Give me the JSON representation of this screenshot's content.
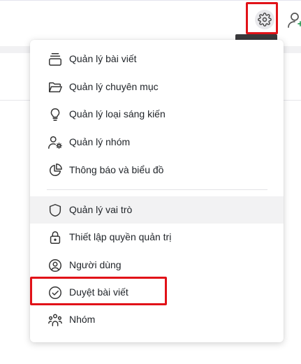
{
  "header": {
    "settings_icon": "gear-icon",
    "user_icon": "user-add-icon"
  },
  "menu": {
    "group1": [
      {
        "label": "Quản lý bài viết",
        "icon": "articles-icon"
      },
      {
        "label": "Quản lý chuyên mục",
        "icon": "folder-icon"
      },
      {
        "label": "Quản lý loại sáng kiến",
        "icon": "lightbulb-icon"
      },
      {
        "label": "Quản lý nhóm",
        "icon": "user-gear-icon"
      },
      {
        "label": "Thông báo và biểu đồ",
        "icon": "pie-chart-icon"
      }
    ],
    "group2": [
      {
        "label": "Quản lý vai trò",
        "icon": "shield-icon"
      },
      {
        "label": "Thiết lập quyền quản trị",
        "icon": "lock-icon"
      },
      {
        "label": "Người dùng",
        "icon": "user-circle-icon"
      },
      {
        "label": "Duyệt bài viết",
        "icon": "check-circle-icon"
      },
      {
        "label": "Nhóm",
        "icon": "group-icon"
      }
    ]
  },
  "colors": {
    "highlight": "#e11218",
    "active_row": "#f2f2f3"
  }
}
